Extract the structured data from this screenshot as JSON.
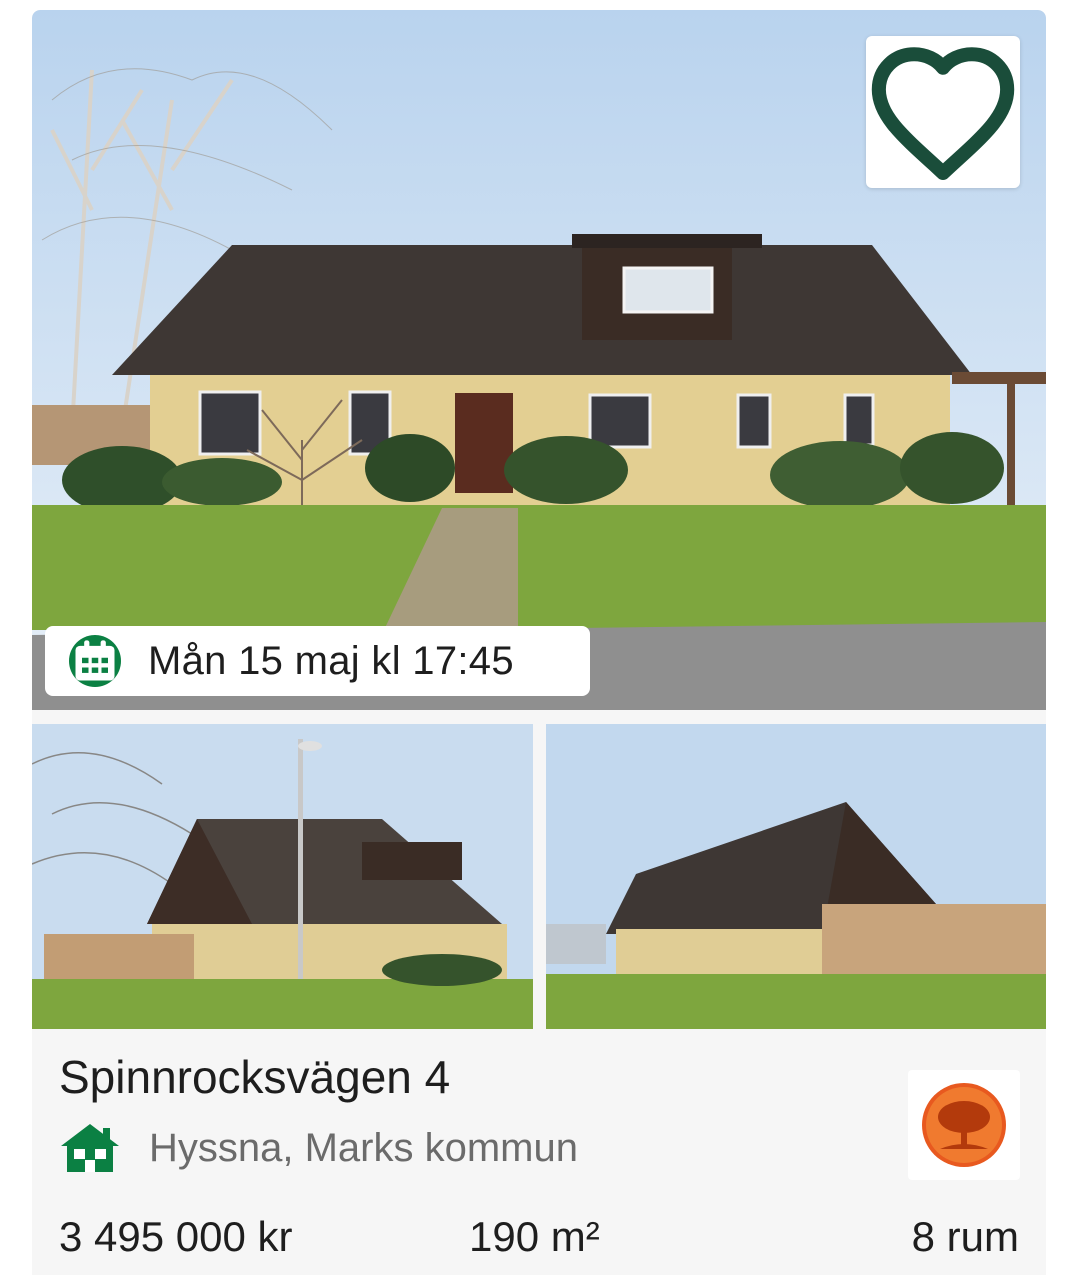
{
  "listing": {
    "viewing_text": "Mån 15 maj kl 17:45",
    "address": "Spinnrocksvägen 4",
    "location": "Hyssna, Marks kommun",
    "price": "3 495 000 kr",
    "area": "190 m²",
    "rooms": "8 rum"
  },
  "icons": {
    "favorite": "heart-outline-icon",
    "viewing": "calendar-icon",
    "type": "house-icon"
  },
  "colors": {
    "accent": "#0b8043",
    "heart": "#1a4d3a",
    "broker_logo": "#e8591f"
  }
}
